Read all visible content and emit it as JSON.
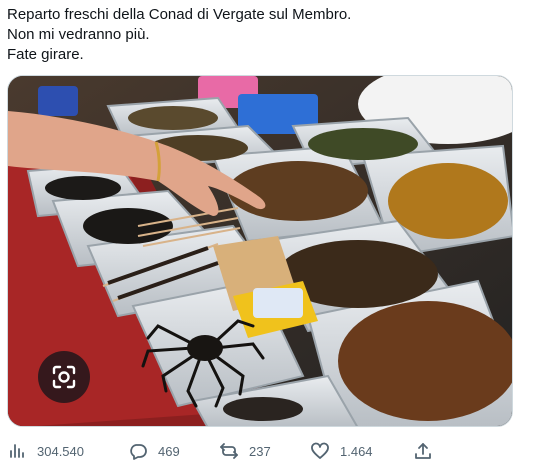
{
  "tweet": {
    "lines": [
      "Reparto freschi della Conad di Vergate sul Membro.",
      "Non mi vedranno più.",
      "Fate girare."
    ]
  },
  "media": {
    "lens_button_icon": "visual-search-icon"
  },
  "actions": {
    "views": {
      "icon": "views-chart-icon",
      "count": "304.540"
    },
    "replies": {
      "icon": "reply-bubble-icon",
      "count": "469"
    },
    "retweets": {
      "icon": "retweet-icon",
      "count": "237"
    },
    "likes": {
      "icon": "heart-icon",
      "count": "1.464"
    },
    "share": {
      "icon": "share-upload-icon"
    }
  }
}
